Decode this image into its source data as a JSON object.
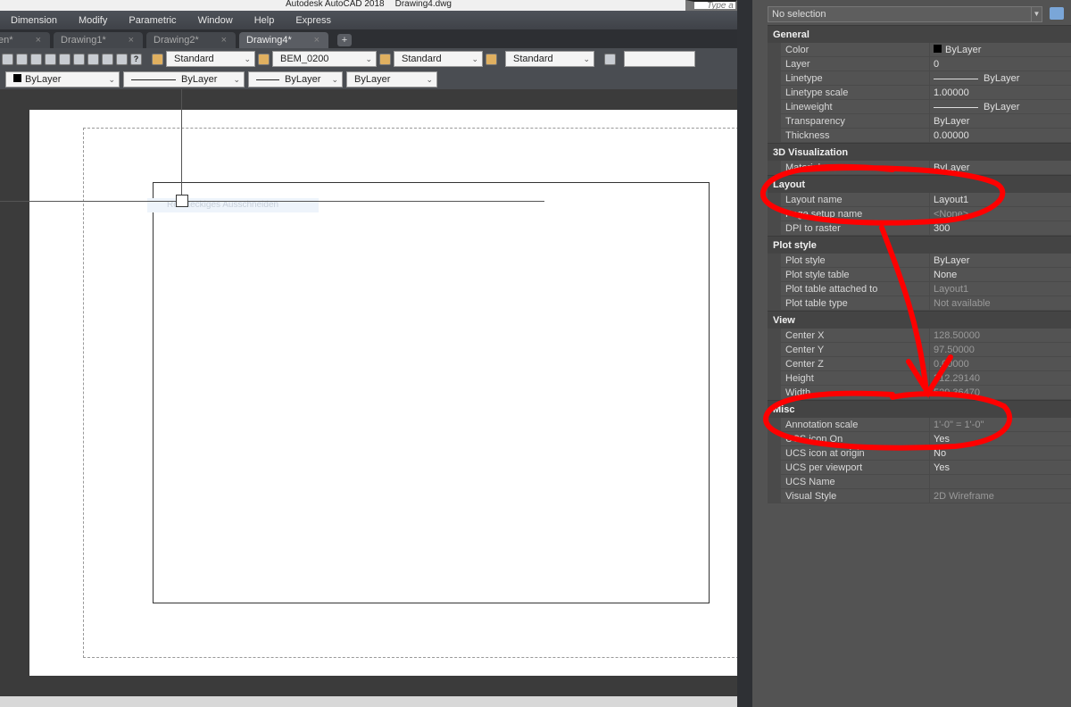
{
  "title": {
    "app": "Autodesk AutoCAD 2018",
    "file": "Drawing4.dwg",
    "search_placeholder": "Type a key"
  },
  "menu": [
    "Dimension",
    "Modify",
    "Parametric",
    "Window",
    "Help",
    "Express"
  ],
  "tabs": [
    {
      "label": "en*",
      "active": false
    },
    {
      "label": "Drawing1*",
      "active": false
    },
    {
      "label": "Drawing2*",
      "active": false
    },
    {
      "label": "Drawing4*",
      "active": true
    }
  ],
  "tab_close": "×",
  "tab_add": "+",
  "toolbar": {
    "text_style": "Standard",
    "dim_style": "BEM_0200",
    "table_style": "Standard",
    "mleader_style": "Standard",
    "help": "?"
  },
  "props_toolbar": {
    "color": "ByLayer",
    "linetype": "ByLayer",
    "lineweight": "ByLayer",
    "plotstyle": "ByLayer"
  },
  "canvas": {
    "tooltip": "Rechteckiges Ausschneiden"
  },
  "palette": {
    "selection": "No selection",
    "sections": [
      {
        "title": "General",
        "rows": [
          [
            "Color",
            "ByLayer"
          ],
          [
            "Layer",
            "0"
          ],
          [
            "Linetype",
            "ByLayer"
          ],
          [
            "Linetype scale",
            "1.00000"
          ],
          [
            "Lineweight",
            "ByLayer"
          ],
          [
            "Transparency",
            "ByLayer"
          ],
          [
            "Thickness",
            "0.00000"
          ]
        ]
      },
      {
        "title": "3D Visualization",
        "rows": [
          [
            "Material",
            "ByLayer"
          ]
        ]
      },
      {
        "title": "Layout",
        "rows": [
          [
            "Layout name",
            "Layout1"
          ],
          [
            "Page setup name",
            "<None>"
          ],
          [
            "DPI to raster",
            "300"
          ]
        ]
      },
      {
        "title": "Plot style",
        "rows": [
          [
            "Plot style",
            "ByLayer"
          ],
          [
            "Plot style table",
            "None"
          ],
          [
            "Plot table attached to",
            "Layout1"
          ],
          [
            "Plot table type",
            "Not available"
          ]
        ]
      },
      {
        "title": "View",
        "rows": [
          [
            "Center X",
            "128.50000"
          ],
          [
            "Center Y",
            "97.50000"
          ],
          [
            "Center Z",
            "0.00000"
          ],
          [
            "Height",
            "312.29140"
          ],
          [
            "Width",
            "529.36470"
          ]
        ]
      },
      {
        "title": "Misc",
        "rows": [
          [
            "Annotation scale",
            "1'-0\" = 1'-0\""
          ],
          [
            "UCS icon On",
            "Yes"
          ],
          [
            "UCS icon at origin",
            "No"
          ],
          [
            "UCS per viewport",
            "Yes"
          ],
          [
            "UCS Name",
            ""
          ],
          [
            "Visual Style",
            "2D Wireframe"
          ]
        ]
      }
    ]
  },
  "colors": {
    "annotation": "#ff0000"
  }
}
